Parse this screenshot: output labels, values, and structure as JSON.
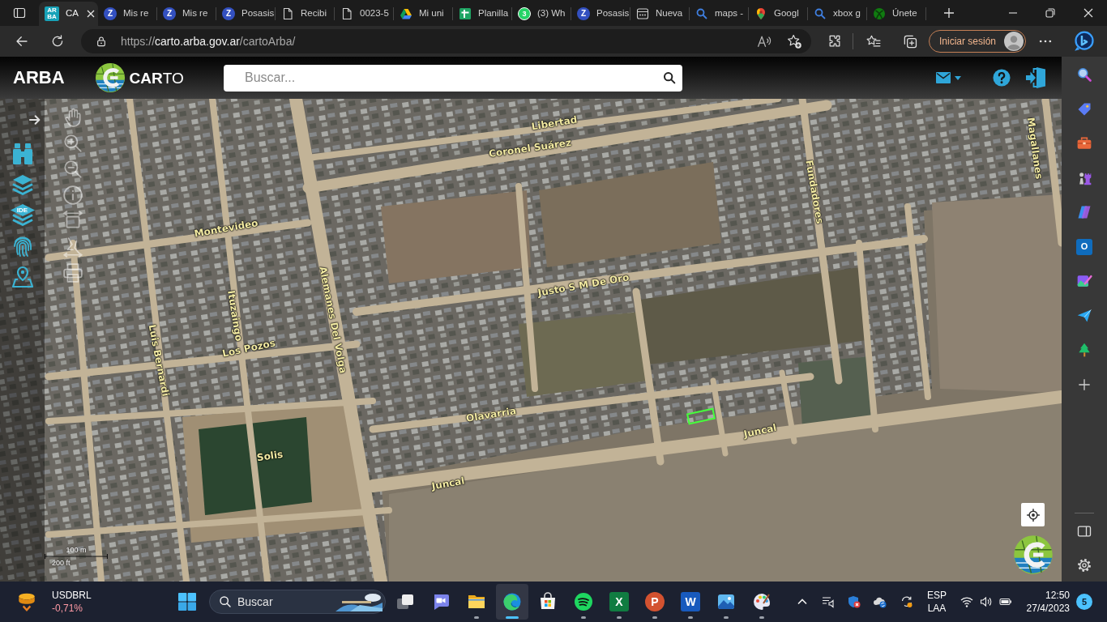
{
  "browser": {
    "tabs": [
      {
        "title": "CA",
        "kind": "arba",
        "icon_text": "ARBA",
        "selected": true
      },
      {
        "title": "Mis re",
        "kind": "zoom",
        "icon_text": "Z",
        "selected": false
      },
      {
        "title": "Mis re",
        "kind": "zoom",
        "icon_text": "Z",
        "selected": false
      },
      {
        "title": "Posasis",
        "kind": "zoom",
        "icon_text": "Z",
        "selected": false
      },
      {
        "title": "Recibi",
        "kind": "file",
        "selected": false
      },
      {
        "title": "0023-5",
        "kind": "file",
        "selected": false
      },
      {
        "title": "Mi uni",
        "kind": "drive",
        "selected": false
      },
      {
        "title": "Planilla",
        "kind": "sheet",
        "selected": false
      },
      {
        "title": "(3) Wh",
        "kind": "chat",
        "icon_text": "3",
        "selected": false
      },
      {
        "title": "Posasis",
        "kind": "zoom",
        "icon_text": "Z",
        "selected": false
      },
      {
        "title": "Nueva",
        "kind": "form",
        "selected": false
      },
      {
        "title": "maps -",
        "kind": "search",
        "selected": false
      },
      {
        "title": "Googl",
        "kind": "pin",
        "selected": false
      },
      {
        "title": "xbox g",
        "kind": "search",
        "selected": false
      },
      {
        "title": "Únete",
        "kind": "xbox",
        "selected": false
      }
    ],
    "address": {
      "scheme": "https://",
      "host": "carto.arba.gov.ar",
      "path": "/cartoArba/"
    },
    "sign_in": "Iniciar sesión",
    "sidebar": [
      {
        "kind": "search"
      },
      {
        "kind": "tag"
      },
      {
        "kind": "toolbox"
      },
      {
        "kind": "games"
      },
      {
        "kind": "copilot"
      },
      {
        "kind": "mail",
        "icon_text": "O"
      },
      {
        "kind": "designer"
      },
      {
        "kind": "send"
      },
      {
        "kind": "tree"
      },
      {
        "kind": "add"
      }
    ]
  },
  "app": {
    "brand": "ARBA",
    "logo_text": "**CAR**TO",
    "search": {
      "placeholder": "Buscar..."
    },
    "tools": [
      {
        "kind": "binoculars"
      },
      {
        "kind": "layers"
      },
      {
        "kind": "ide",
        "icon_text": "IDE"
      },
      {
        "kind": "fingerprint"
      },
      {
        "kind": "place"
      }
    ]
  },
  "map": {
    "street_labels": [
      "Libertad",
      "Coronel Suárez",
      "Fundadores",
      "Magallanes",
      "Montevideo",
      "Justo S M De Oro",
      "Alemanes Del Volga",
      "Ituzaingo",
      "Luis Bernardi",
      "Los Pozos",
      "Olavarria",
      "Juncal",
      "Solis",
      "Juncal"
    ],
    "scale": {
      "metric": "100 m",
      "imperial": "200 ft"
    }
  },
  "taskbar": {
    "ticker": {
      "symbol": "USDBRL",
      "change": "-0,71%"
    },
    "search": {
      "placeholder": "Buscar"
    },
    "apps": [
      {
        "kind": "taskview",
        "running": false,
        "selected": false
      },
      {
        "kind": "meet",
        "running": false,
        "selected": false
      },
      {
        "kind": "folder",
        "running": true,
        "selected": false
      },
      {
        "kind": "browser",
        "running": true,
        "selected": true
      },
      {
        "kind": "store",
        "running": false,
        "selected": false
      },
      {
        "kind": "music",
        "running": true,
        "selected": false
      },
      {
        "kind": "sheet",
        "icon_text": "X",
        "running": true,
        "selected": false
      },
      {
        "kind": "slides",
        "icon_text": "P",
        "running": true,
        "selected": false
      },
      {
        "kind": "doc",
        "icon_text": "W",
        "running": true,
        "selected": false
      },
      {
        "kind": "photos",
        "running": true,
        "selected": false
      },
      {
        "kind": "paint",
        "running": true,
        "selected": false
      }
    ],
    "language": {
      "input": "ESP",
      "layout": "LAA"
    },
    "time": "12:50",
    "date": "27/4/2023",
    "notifications": "5"
  }
}
